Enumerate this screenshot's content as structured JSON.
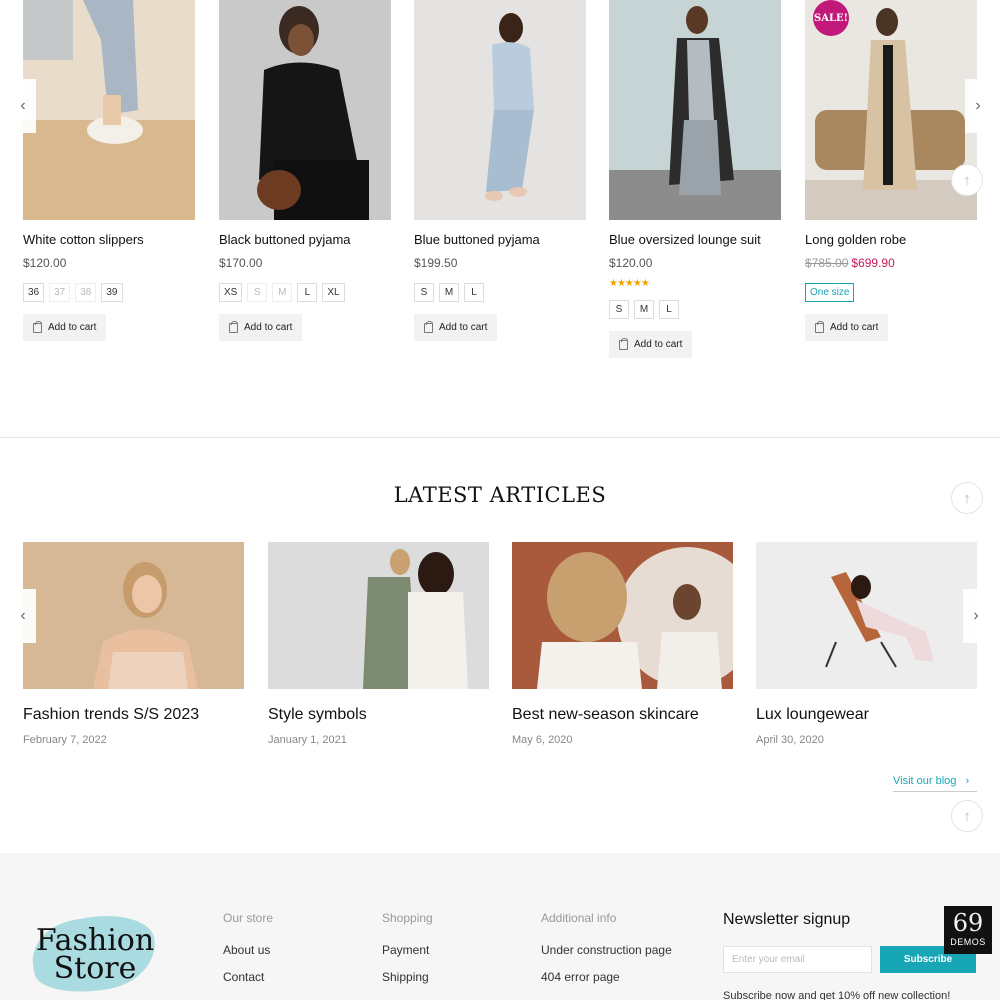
{
  "products": [
    {
      "title": "White cotton slippers",
      "price": "$120.00",
      "sizes": [
        {
          "label": "36",
          "available": true
        },
        {
          "label": "37",
          "available": false
        },
        {
          "label": "38",
          "available": false
        },
        {
          "label": "39",
          "available": true
        }
      ],
      "cart_label": "Add to cart"
    },
    {
      "title": "Black buttoned pyjama",
      "price": "$170.00",
      "sizes": [
        {
          "label": "XS",
          "available": true
        },
        {
          "label": "S",
          "available": false
        },
        {
          "label": "M",
          "available": false
        },
        {
          "label": "L",
          "available": true
        },
        {
          "label": "XL",
          "available": true
        }
      ],
      "cart_label": "Add to cart"
    },
    {
      "title": "Blue buttoned pyjama",
      "price": "$199.50",
      "sizes": [
        {
          "label": "S",
          "available": true
        },
        {
          "label": "M",
          "available": true
        },
        {
          "label": "L",
          "available": true
        }
      ],
      "cart_label": "Add to cart"
    },
    {
      "title": "Blue oversized lounge suit",
      "price": "$120.00",
      "rating": "★★★★★",
      "rating_value": 4.5,
      "sizes": [
        {
          "label": "S",
          "available": true
        },
        {
          "label": "M",
          "available": true
        },
        {
          "label": "L",
          "available": true
        }
      ],
      "cart_label": "Add to cart"
    },
    {
      "title": "Long golden robe",
      "old_price": "$785.00",
      "price": "$699.90",
      "badge": "SALE!",
      "one_size": "One size",
      "cart_label": "Add to cart"
    }
  ],
  "carousel": {
    "prev_icon": "‹",
    "next_icon": "›",
    "top_icon": "↑"
  },
  "articles_section": {
    "title": "LATEST ARTICLES",
    "items": [
      {
        "title": "Fashion trends S/S 2023",
        "date": "February 7, 2022"
      },
      {
        "title": "Style symbols",
        "date": "January 1, 2021"
      },
      {
        "title": "Best new-season skincare",
        "date": "May 6, 2020"
      },
      {
        "title": "Lux loungewear",
        "date": "April 30, 2020"
      }
    ],
    "blog_link": "Visit our blog",
    "blog_icon": "›"
  },
  "footer": {
    "logo_line1": "Fashion",
    "logo_line2": "Store",
    "columns": [
      {
        "heading": "Our store",
        "links": [
          "About us",
          "Contact"
        ]
      },
      {
        "heading": "Shopping",
        "links": [
          "Payment",
          "Shipping"
        ]
      },
      {
        "heading": "Additional info",
        "links": [
          "Under construction page",
          "404 error page"
        ]
      }
    ],
    "newsletter": {
      "title": "Newsletter signup",
      "placeholder": "Enter your email",
      "button": "Subscribe",
      "text": "Subscribe now and get 10% off new collection!"
    },
    "demos": {
      "number": "69",
      "label": "DEMOS"
    }
  },
  "colors": {
    "accent": "#17a6b6",
    "sale": "#c2185b",
    "badge": "#c2187a"
  }
}
